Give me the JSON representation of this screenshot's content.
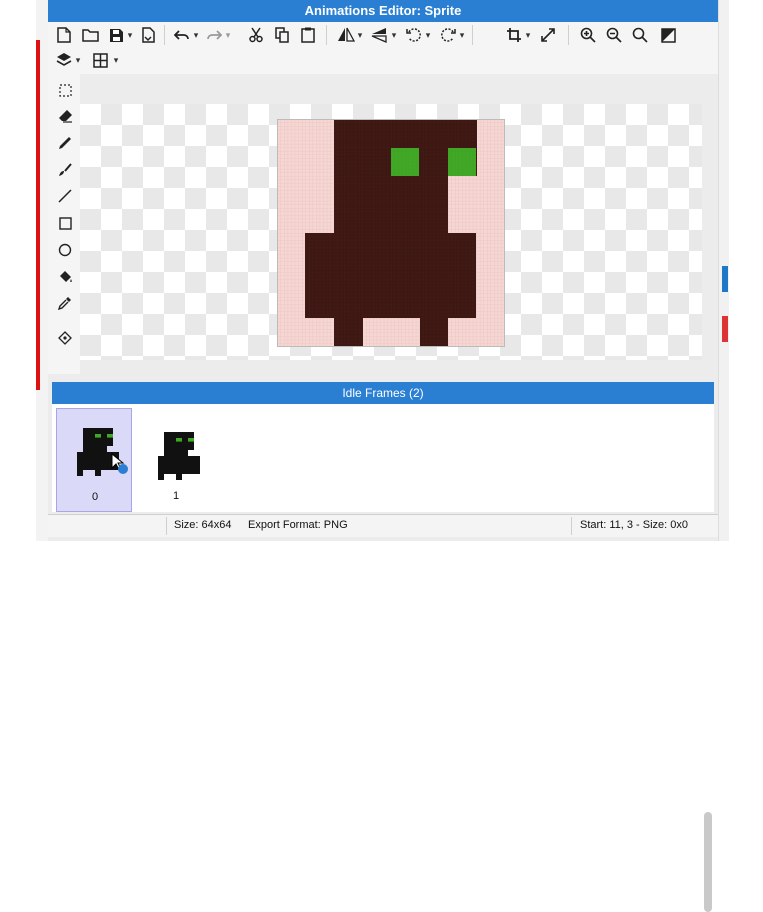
{
  "window": {
    "title": "Animations Editor: Sprite"
  },
  "toolbar": {
    "icons": [
      "new-file-icon",
      "open-folder-icon",
      "save-icon",
      "export-icon",
      "undo-icon",
      "redo-icon",
      "cut-icon",
      "copy-icon",
      "paste-icon",
      "flip-horizontal-icon",
      "flip-vertical-icon",
      "rotate-left-icon",
      "rotate-right-icon",
      "crop-icon",
      "resize-icon",
      "zoom-in-icon",
      "zoom-out-icon",
      "zoom-fit-icon",
      "toggle-background-icon",
      "layers-icon",
      "grid-icon"
    ]
  },
  "side_tools": [
    "select-icon",
    "eraser-icon",
    "pencil-icon",
    "brush-icon",
    "line-icon",
    "rectangle-icon",
    "ellipse-icon",
    "fill-bucket-icon",
    "eyedropper-icon",
    "pivot-icon"
  ],
  "frames": {
    "header": "Idle Frames (2)",
    "items": [
      {
        "label": "0",
        "selected": true
      },
      {
        "label": "1",
        "selected": false
      }
    ]
  },
  "status": {
    "size": "Size: 64x64",
    "export_format": "Export Format: PNG",
    "selection": "Start: 11, 3 - Size: 0x0"
  },
  "colors": {
    "accent": "#2a7fd2",
    "sprite_body": "#3d1712",
    "sprite_bg": "#f6d6d2",
    "sprite_eyes": "#3fa925",
    "thumb_selected": "#dad9f7"
  }
}
